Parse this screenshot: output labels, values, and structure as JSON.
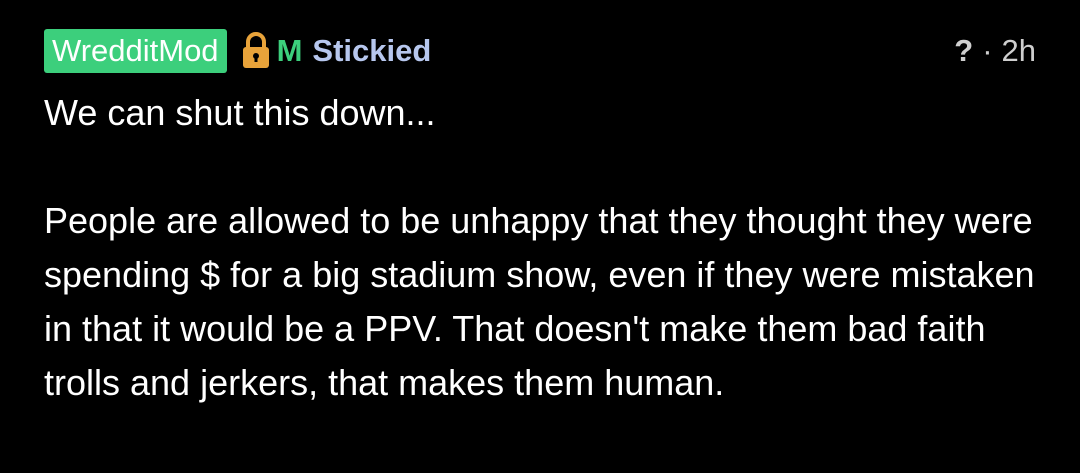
{
  "comment": {
    "author": "WredditMod",
    "mod_marker": "M",
    "stickied_label": "Stickied",
    "unknown_glyph": "?",
    "separator": "·",
    "age": "2h",
    "paragraphs": [
      "We can shut this down...",
      "People are allowed to be unhappy that they thought they were spending $ for a big stadium show, even if they were mistaken in that it would be a PPV. That doesn't make them bad faith trolls and jerkers, that makes them human."
    ]
  },
  "icons": {
    "lock": "lock-icon"
  },
  "colors": {
    "background": "#000000",
    "author_badge": "#3ccf7c",
    "mod_marker": "#3ccf7c",
    "stickied": "#b7c7ee",
    "lock": "#e8a33a",
    "body_text": "#ffffff",
    "meta": "#cfcfcf"
  }
}
